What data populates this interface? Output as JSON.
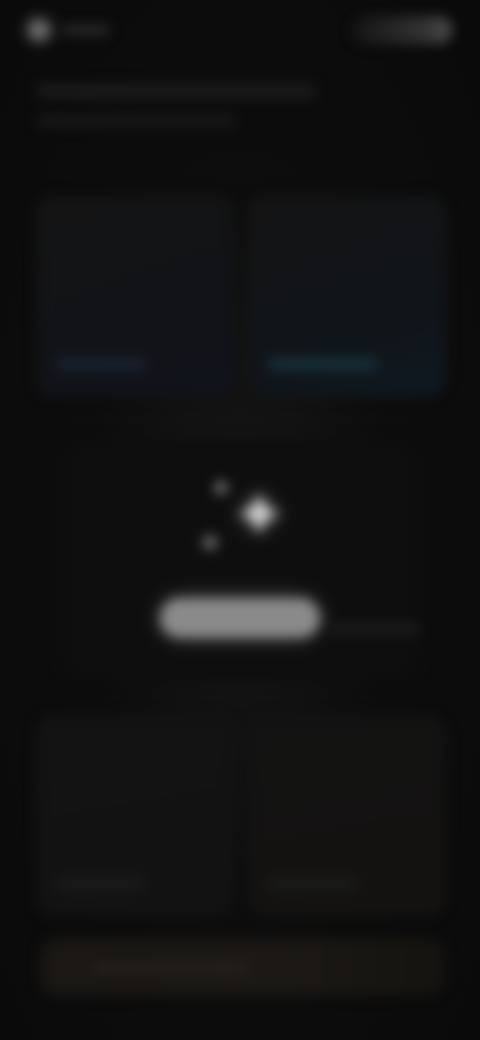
{
  "screen": {
    "state": "blurred"
  },
  "icons": {
    "brand": "circle-logo-icon",
    "hero": "sparkle-icon"
  },
  "colors": {
    "background": "#0c0c0c",
    "card_blue_tint": "#10131b",
    "card_teal_tint": "#0f1a22",
    "hero_button": "#8a8a8a",
    "bottom_bar": "#1a1714"
  }
}
